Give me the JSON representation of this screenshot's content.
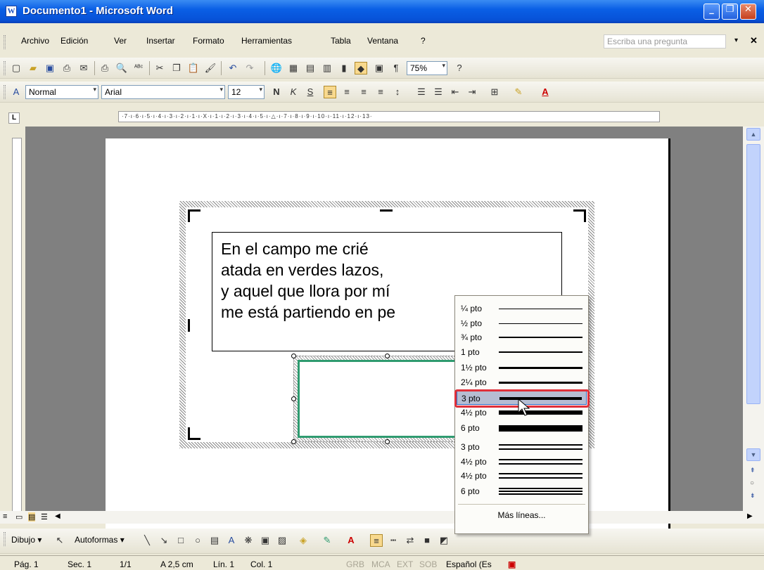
{
  "window": {
    "title": "Documento1 - Microsoft Word"
  },
  "menus": [
    "Archivo",
    "Edición",
    "Ver",
    "Insertar",
    "Formato",
    "Herramientas",
    "Tabla",
    "Ventana",
    "?"
  ],
  "help_box": {
    "placeholder": "Escriba una pregunta"
  },
  "standard_toolbar": {
    "zoom": "75%"
  },
  "format_toolbar": {
    "style": "Normal",
    "font": "Arial",
    "size": "12"
  },
  "ruler": {
    "marks": "·7·ı·6·ı·5·ı·4·ı·3·ı·2·ı·1·ı·X·ı·1·ı·2·ı·3·ı·4·ı·5·ı·△·ı·7·ı·8·ı·9·ı·10·ı·11·ı·12·ı·13·"
  },
  "document": {
    "lines": [
      "En el campo me crié",
      "atada en verdes lazos,",
      "y aquel que llora por mí",
      "me está partiendo en pe"
    ]
  },
  "line_menu": {
    "items": [
      {
        "label": "¼ pto",
        "weight": 1
      },
      {
        "label": "½ pto",
        "weight": 1
      },
      {
        "label": "¾ pto",
        "weight": 2
      },
      {
        "label": "1 pto",
        "weight": 2
      },
      {
        "label": "1½ pto",
        "weight": 3
      },
      {
        "label": "2¼ pto",
        "weight": 3
      },
      {
        "label": "3 pto",
        "weight": 4,
        "selected": true
      },
      {
        "label": "4½ pto",
        "weight": 6
      },
      {
        "label": "6 pto",
        "weight": 9
      },
      {
        "label": "3 pto",
        "weight": 4,
        "double": true
      },
      {
        "label": "4½ pto",
        "weight": 5,
        "double": true
      },
      {
        "label": "4½ pto",
        "weight": 5,
        "double": true
      },
      {
        "label": "6 pto",
        "weight": 6,
        "triple": true
      }
    ],
    "more": "Más líneas..."
  },
  "drawing_toolbar": {
    "draw": "Dibujo",
    "autoshapes": "Autoformas"
  },
  "status": {
    "page": "Pág. 1",
    "sec": "Sec. 1",
    "pages": "1/1",
    "at": "A 2,5 cm",
    "line": "Lín. 1",
    "col": "Col. 1",
    "grb": "GRB",
    "mca": "MCA",
    "ext": "EXT",
    "sob": "SOB",
    "lang": "Español (Es"
  },
  "colors": {
    "title": "#0A5FE5",
    "selection": "#B6BDD2",
    "highlight": "#E0303A",
    "shape_border": "#2F9B70"
  }
}
